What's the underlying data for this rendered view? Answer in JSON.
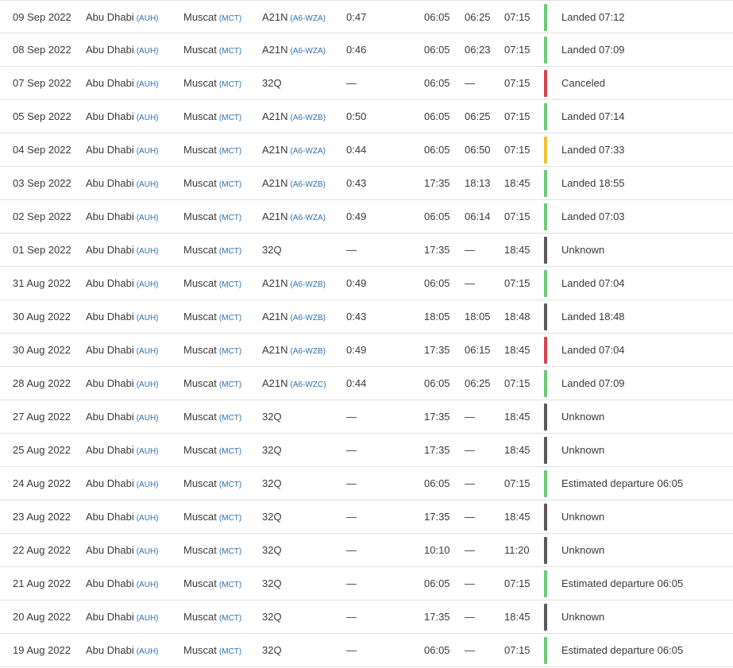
{
  "colors": {
    "green": "#6cca74",
    "red": "#d9434a",
    "yellow": "#f0c030",
    "gray": "#595959"
  },
  "flights": [
    {
      "date": "09 Sep 2022",
      "from": "Abu Dhabi",
      "from_code": "(AUH)",
      "to": "Muscat",
      "to_code": "(MCT)",
      "aircraft": "A21N",
      "reg": "(A6-WZA)",
      "duration": "0:47",
      "std": "06:05",
      "atd": "06:25",
      "sta": "07:15",
      "status_color": "green",
      "status": "Landed 07:12"
    },
    {
      "date": "08 Sep 2022",
      "from": "Abu Dhabi",
      "from_code": "(AUH)",
      "to": "Muscat",
      "to_code": "(MCT)",
      "aircraft": "A21N",
      "reg": "(A6-WZA)",
      "duration": "0:46",
      "std": "06:05",
      "atd": "06:23",
      "sta": "07:15",
      "status_color": "green",
      "status": "Landed 07:09"
    },
    {
      "date": "07 Sep 2022",
      "from": "Abu Dhabi",
      "from_code": "(AUH)",
      "to": "Muscat",
      "to_code": "(MCT)",
      "aircraft": "32Q",
      "reg": "",
      "duration": "—",
      "std": "06:05",
      "atd": "—",
      "sta": "07:15",
      "status_color": "red",
      "status": "Canceled"
    },
    {
      "date": "05 Sep 2022",
      "from": "Abu Dhabi",
      "from_code": "(AUH)",
      "to": "Muscat",
      "to_code": "(MCT)",
      "aircraft": "A21N",
      "reg": "(A6-WZB)",
      "duration": "0:50",
      "std": "06:05",
      "atd": "06:25",
      "sta": "07:15",
      "status_color": "green",
      "status": "Landed 07:14"
    },
    {
      "date": "04 Sep 2022",
      "from": "Abu Dhabi",
      "from_code": "(AUH)",
      "to": "Muscat",
      "to_code": "(MCT)",
      "aircraft": "A21N",
      "reg": "(A6-WZA)",
      "duration": "0:44",
      "std": "06:05",
      "atd": "06:50",
      "sta": "07:15",
      "status_color": "yellow",
      "status": "Landed 07:33"
    },
    {
      "date": "03 Sep 2022",
      "from": "Abu Dhabi",
      "from_code": "(AUH)",
      "to": "Muscat",
      "to_code": "(MCT)",
      "aircraft": "A21N",
      "reg": "(A6-WZB)",
      "duration": "0:43",
      "std": "17:35",
      "atd": "18:13",
      "sta": "18:45",
      "status_color": "green",
      "status": "Landed 18:55"
    },
    {
      "date": "02 Sep 2022",
      "from": "Abu Dhabi",
      "from_code": "(AUH)",
      "to": "Muscat",
      "to_code": "(MCT)",
      "aircraft": "A21N",
      "reg": "(A6-WZA)",
      "duration": "0:49",
      "std": "06:05",
      "atd": "06:14",
      "sta": "07:15",
      "status_color": "green",
      "status": "Landed 07:03"
    },
    {
      "date": "01 Sep 2022",
      "from": "Abu Dhabi",
      "from_code": "(AUH)",
      "to": "Muscat",
      "to_code": "(MCT)",
      "aircraft": "32Q",
      "reg": "",
      "duration": "—",
      "std": "17:35",
      "atd": "—",
      "sta": "18:45",
      "status_color": "gray",
      "status": "Unknown"
    },
    {
      "date": "31 Aug 2022",
      "from": "Abu Dhabi",
      "from_code": "(AUH)",
      "to": "Muscat",
      "to_code": "(MCT)",
      "aircraft": "A21N",
      "reg": "(A6-WZB)",
      "duration": "0:49",
      "std": "06:05",
      "atd": "—",
      "sta": "07:15",
      "status_color": "green",
      "status": "Landed 07:04"
    },
    {
      "date": "30 Aug 2022",
      "from": "Abu Dhabi",
      "from_code": "(AUH)",
      "to": "Muscat",
      "to_code": "(MCT)",
      "aircraft": "A21N",
      "reg": "(A6-WZB)",
      "duration": "0:43",
      "std": "18:05",
      "atd": "18:05",
      "sta": "18:48",
      "status_color": "gray",
      "status": "Landed 18:48"
    },
    {
      "date": "30 Aug 2022",
      "from": "Abu Dhabi",
      "from_code": "(AUH)",
      "to": "Muscat",
      "to_code": "(MCT)",
      "aircraft": "A21N",
      "reg": "(A6-WZB)",
      "duration": "0:49",
      "std": "17:35",
      "atd": "06:15",
      "sta": "18:45",
      "status_color": "red",
      "status": "Landed 07:04"
    },
    {
      "date": "28 Aug 2022",
      "from": "Abu Dhabi",
      "from_code": "(AUH)",
      "to": "Muscat",
      "to_code": "(MCT)",
      "aircraft": "A21N",
      "reg": "(A6-WZC)",
      "duration": "0:44",
      "std": "06:05",
      "atd": "06:25",
      "sta": "07:15",
      "status_color": "green",
      "status": "Landed 07:09"
    },
    {
      "date": "27 Aug 2022",
      "from": "Abu Dhabi",
      "from_code": "(AUH)",
      "to": "Muscat",
      "to_code": "(MCT)",
      "aircraft": "32Q",
      "reg": "",
      "duration": "—",
      "std": "17:35",
      "atd": "—",
      "sta": "18:45",
      "status_color": "gray",
      "status": "Unknown"
    },
    {
      "date": "25 Aug 2022",
      "from": "Abu Dhabi",
      "from_code": "(AUH)",
      "to": "Muscat",
      "to_code": "(MCT)",
      "aircraft": "32Q",
      "reg": "",
      "duration": "—",
      "std": "17:35",
      "atd": "—",
      "sta": "18:45",
      "status_color": "gray",
      "status": "Unknown"
    },
    {
      "date": "24 Aug 2022",
      "from": "Abu Dhabi",
      "from_code": "(AUH)",
      "to": "Muscat",
      "to_code": "(MCT)",
      "aircraft": "32Q",
      "reg": "",
      "duration": "—",
      "std": "06:05",
      "atd": "—",
      "sta": "07:15",
      "status_color": "green",
      "status": "Estimated departure 06:05"
    },
    {
      "date": "23 Aug 2022",
      "from": "Abu Dhabi",
      "from_code": "(AUH)",
      "to": "Muscat",
      "to_code": "(MCT)",
      "aircraft": "32Q",
      "reg": "",
      "duration": "—",
      "std": "17:35",
      "atd": "—",
      "sta": "18:45",
      "status_color": "gray",
      "status": "Unknown"
    },
    {
      "date": "22 Aug 2022",
      "from": "Abu Dhabi",
      "from_code": "(AUH)",
      "to": "Muscat",
      "to_code": "(MCT)",
      "aircraft": "32Q",
      "reg": "",
      "duration": "—",
      "std": "10:10",
      "atd": "—",
      "sta": "11:20",
      "status_color": "gray",
      "status": "Unknown"
    },
    {
      "date": "21 Aug 2022",
      "from": "Abu Dhabi",
      "from_code": "(AUH)",
      "to": "Muscat",
      "to_code": "(MCT)",
      "aircraft": "32Q",
      "reg": "",
      "duration": "—",
      "std": "06:05",
      "atd": "—",
      "sta": "07:15",
      "status_color": "green",
      "status": "Estimated departure 06:05"
    },
    {
      "date": "20 Aug 2022",
      "from": "Abu Dhabi",
      "from_code": "(AUH)",
      "to": "Muscat",
      "to_code": "(MCT)",
      "aircraft": "32Q",
      "reg": "",
      "duration": "—",
      "std": "17:35",
      "atd": "—",
      "sta": "18:45",
      "status_color": "gray",
      "status": "Unknown"
    },
    {
      "date": "19 Aug 2022",
      "from": "Abu Dhabi",
      "from_code": "(AUH)",
      "to": "Muscat",
      "to_code": "(MCT)",
      "aircraft": "32Q",
      "reg": "",
      "duration": "—",
      "std": "06:05",
      "atd": "—",
      "sta": "07:15",
      "status_color": "green",
      "status": "Estimated departure 06:05"
    }
  ]
}
